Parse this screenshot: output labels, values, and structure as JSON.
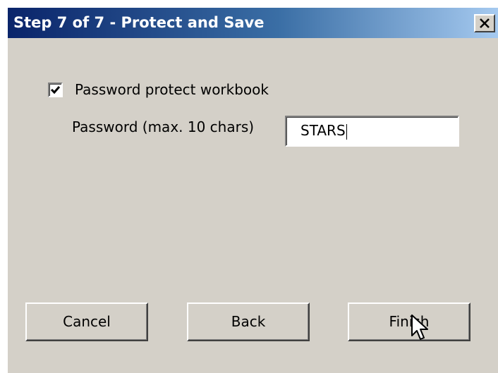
{
  "window": {
    "title": "Step 7 of 7 - Protect and Save",
    "close_glyph": "close-icon"
  },
  "options": {
    "protect_label": "Password protect workbook",
    "protect_checked": true,
    "password_label": "Password (max. 10 chars)",
    "password_value": "STARS"
  },
  "buttons": {
    "cancel": "Cancel",
    "back": "Back",
    "finish": "Finish"
  },
  "colors": {
    "dialog_bg": "#d4d0c8",
    "title_start": "#0a246a",
    "title_end": "#a6caf0"
  }
}
